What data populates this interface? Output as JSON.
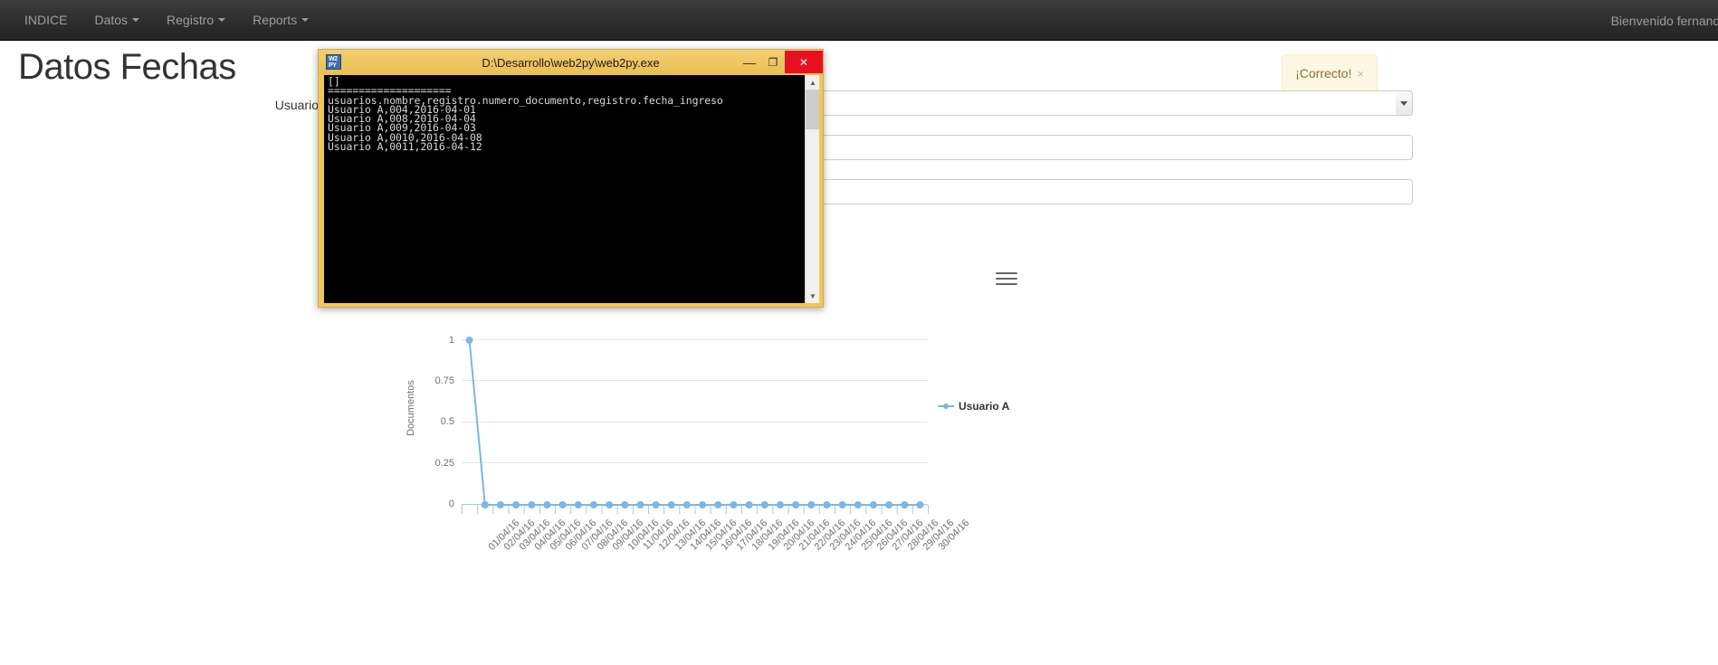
{
  "navbar": {
    "brand": "INDICE",
    "items": [
      {
        "label": "Datos",
        "caret": true
      },
      {
        "label": "Registro",
        "caret": true
      },
      {
        "label": "Reports",
        "caret": true
      }
    ],
    "welcome": "Bienvenido fernando"
  },
  "page": {
    "title": "Datos Fechas"
  },
  "alert": {
    "text": "¡Correcto!",
    "close": "×"
  },
  "form": {
    "label_usuario": "Usuario",
    "select_value": "",
    "input_1_value": "",
    "input_2_value": "",
    "placeholder_1": "",
    "placeholder_2": ""
  },
  "console": {
    "title": "D:\\Desarrollo\\web2py\\web2py.exe",
    "icon_label": "W2PY",
    "minimize": "—",
    "maximize": "❐",
    "close": "✕",
    "scroll_up": "▲",
    "scroll_down": "▼",
    "lines": [
      "[]",
      "====================",
      "usuarios.nombre,registro.numero_documento,registro.fecha_ingreso",
      "Usuario A,004,2016-04-01",
      "Usuario A,008,2016-04-04",
      "Usuario A,009,2016-04-03",
      "Usuario A,0010,2016-04-08",
      "Usuario A,0011,2016-04-12"
    ]
  },
  "chart_data": {
    "type": "line",
    "title": "",
    "xlabel": "",
    "ylabel": "Documentos",
    "ylim": [
      0,
      1
    ],
    "yticks": [
      "0",
      "0.25",
      "0.5",
      "0.75",
      "1"
    ],
    "grid": true,
    "legend_position": "right",
    "categories": [
      "01/04/16",
      "02/04/16",
      "03/04/16",
      "04/04/16",
      "05/04/16",
      "06/04/16",
      "07/04/16",
      "08/04/16",
      "09/04/16",
      "10/04/16",
      "11/04/16",
      "12/04/16",
      "13/04/16",
      "14/04/16",
      "15/04/16",
      "16/04/16",
      "17/04/16",
      "18/04/16",
      "19/04/16",
      "20/04/16",
      "21/04/16",
      "22/04/16",
      "23/04/16",
      "24/04/16",
      "25/04/16",
      "26/04/16",
      "27/04/16",
      "28/04/16",
      "29/04/16",
      "30/04/16"
    ],
    "series": [
      {
        "name": "Usuario A",
        "color": "#7cb5ec",
        "values": [
          1,
          0,
          0,
          0,
          0,
          0,
          0,
          0,
          0,
          0,
          0,
          0,
          0,
          0,
          0,
          0,
          0,
          0,
          0,
          0,
          0,
          0,
          0,
          0,
          0,
          0,
          0,
          0,
          0,
          0
        ]
      }
    ],
    "menu_icon": "hamburger-menu"
  }
}
